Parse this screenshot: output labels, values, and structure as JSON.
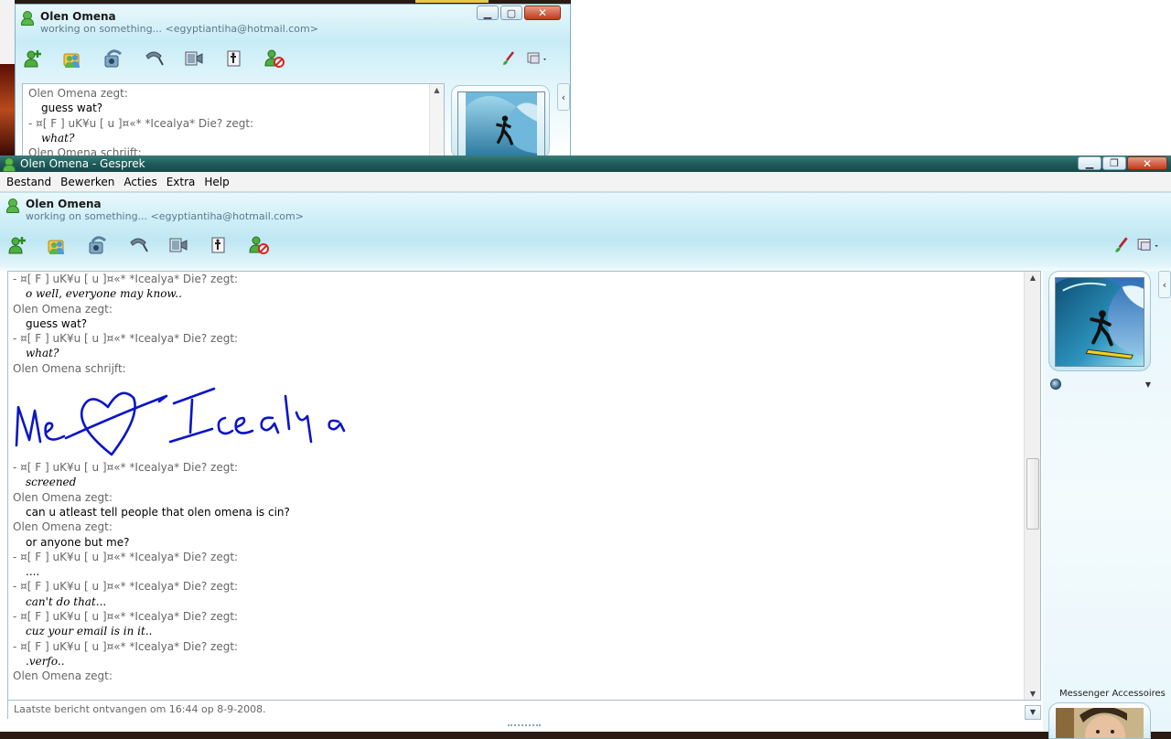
{
  "back_window": {
    "contact_name": "Olen Omena",
    "contact_status": "working on something... <egyptiantiha@hotmail.com>",
    "messages": [
      {
        "type": "sender",
        "text": "Olen Omena zegt:"
      },
      {
        "type": "msg",
        "text": "guess wat?",
        "italic": false
      },
      {
        "type": "sender",
        "text": "-  ¤[ F ] uK¥u [ u ]¤«*  *Icealya* Die? zegt:"
      },
      {
        "type": "msg",
        "text": "what?",
        "italic": true
      },
      {
        "type": "sender",
        "text": "Olen Omena schrijft:"
      }
    ]
  },
  "main_window": {
    "title": "Olen Omena - Gesprek",
    "menu": [
      "Bestand",
      "Bewerken",
      "Acties",
      "Extra",
      "Help"
    ],
    "contact_name": "Olen Omena",
    "contact_status": "working on something... <egyptiantiha@hotmail.com>",
    "toolbar_icons": [
      "invite-contact-icon",
      "share-files-icon",
      "video-call-icon",
      "phone-call-icon",
      "webcam-icon",
      "games-icon",
      "block-icon"
    ],
    "toolbar_right_icons": [
      "paintbrush-icon",
      "display-options-icon"
    ],
    "status_bar": "Laatste bericht ontvangen om 16:44 op 8-9-2008.",
    "accessories_label": "Messenger Accessoires"
  },
  "conversation": {
    "top_lines": [
      {
        "type": "sender",
        "text": "-  ¤[ F ] uK¥u [ u ]¤«*  *Icealya* Die? zegt:"
      },
      {
        "type": "msg",
        "text": "o well, everyone may know..",
        "italic": true
      },
      {
        "type": "sender",
        "text": "Olen Omena zegt:"
      },
      {
        "type": "msg",
        "text": "guess wat?",
        "italic": false
      },
      {
        "type": "sender",
        "text": "-  ¤[ F ] uK¥u [ u ]¤«*  *Icealya* Die? zegt:"
      },
      {
        "type": "msg",
        "text": "what?",
        "italic": true
      },
      {
        "type": "sender",
        "text": "Olen Omena schrijft:"
      }
    ],
    "ink_message": "Me♥Icealya",
    "bottom_lines": [
      {
        "type": "sender",
        "text": "-  ¤[ F ] uK¥u [ u ]¤«*  *Icealya* Die? zegt:"
      },
      {
        "type": "msg",
        "text": "screened",
        "italic": true
      },
      {
        "type": "sender",
        "text": "Olen Omena zegt:"
      },
      {
        "type": "msg",
        "text": "can u atleast tell people that olen omena is cin?",
        "italic": false
      },
      {
        "type": "sender",
        "text": "Olen Omena zegt:"
      },
      {
        "type": "msg",
        "text": "or anyone but me?",
        "italic": false
      },
      {
        "type": "sender",
        "text": "-  ¤[ F ] uK¥u [ u ]¤«*  *Icealya* Die? zegt:"
      },
      {
        "type": "msg",
        "text": "....",
        "italic": true
      },
      {
        "type": "sender",
        "text": "-  ¤[ F ] uK¥u [ u ]¤«*  *Icealya* Die? zegt:"
      },
      {
        "type": "msg",
        "text": "can't do that...",
        "italic": true
      },
      {
        "type": "sender",
        "text": "-  ¤[ F ] uK¥u [ u ]¤«*  *Icealya* Die? zegt:"
      },
      {
        "type": "msg",
        "text": "cuz your email is in it..",
        "italic": true
      },
      {
        "type": "sender",
        "text": "-  ¤[ F ] uK¥u [ u ]¤«*  *Icealya* Die? zegt:"
      },
      {
        "type": "msg",
        "text": ".verfo..",
        "italic": true
      },
      {
        "type": "sender",
        "text": "Olen Omena zegt:"
      }
    ]
  },
  "colors": {
    "titlebar": "#1d5c5a",
    "ink": "#0a14c8",
    "header_gradient": "#bfe7f3"
  }
}
